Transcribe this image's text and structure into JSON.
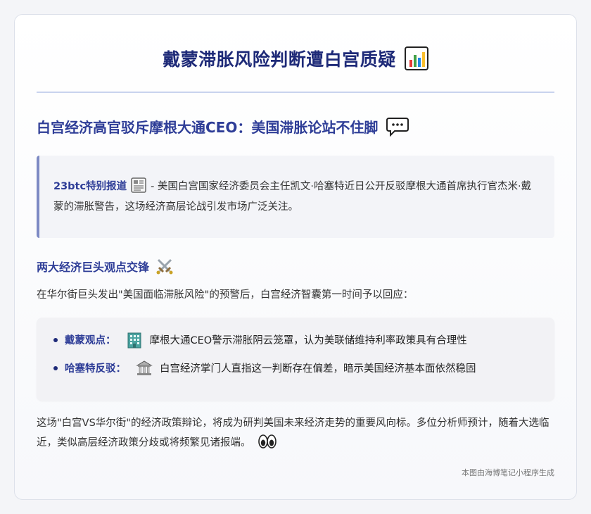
{
  "title": "戴蒙滞胀风险判断遭白宫质疑",
  "title_icon": "bar-chart-icon",
  "subheading": "白宫经济高官驳斥摩根大通CEO：美国滞胀论站不住脚",
  "subheading_icon": "speech-bubble-icon",
  "quote": {
    "lead": "23btc特别报道",
    "lead_icon": "newspaper-icon",
    "text": "- 美国白宫国家经济委员会主任凯文·哈塞特近日公开反驳摩根大通首席执行官杰米·戴蒙的滞胀警告，这场经济高层论战引发市场广泛关注。"
  },
  "section": {
    "heading": "两大经济巨头观点交锋",
    "heading_icon": "crossed-swords-icon",
    "intro": "在华尔街巨头发出\"美国面临滞胀风险\"的预警后，白宫经济智囊第一时间予以回应：",
    "points": [
      {
        "label": "戴蒙观点：",
        "icon": "office-building-icon",
        "text": "摩根大通CEO警示滞胀阴云笼罩，认为美联储维持利率政策具有合理性"
      },
      {
        "label": "哈塞特反驳：",
        "icon": "classical-building-icon",
        "text": "白宫经济掌门人直指这一判断存在偏差，暗示美国经济基本面依然稳固"
      }
    ]
  },
  "conclusion": "这场\"白宫VS华尔街\"的经济政策辩论，将成为研判美国未来经济走势的重要风向标。多位分析师预计，随着大选临近，类似高层经济政策分歧或将频繁见诸报端。",
  "conclusion_icon": "eyes-icon",
  "footer": "本图由海博笔记小程序生成",
  "colors": {
    "heading": "#1e2a78",
    "accent": "#2e3d97",
    "quote_border": "#7d8ac4"
  }
}
